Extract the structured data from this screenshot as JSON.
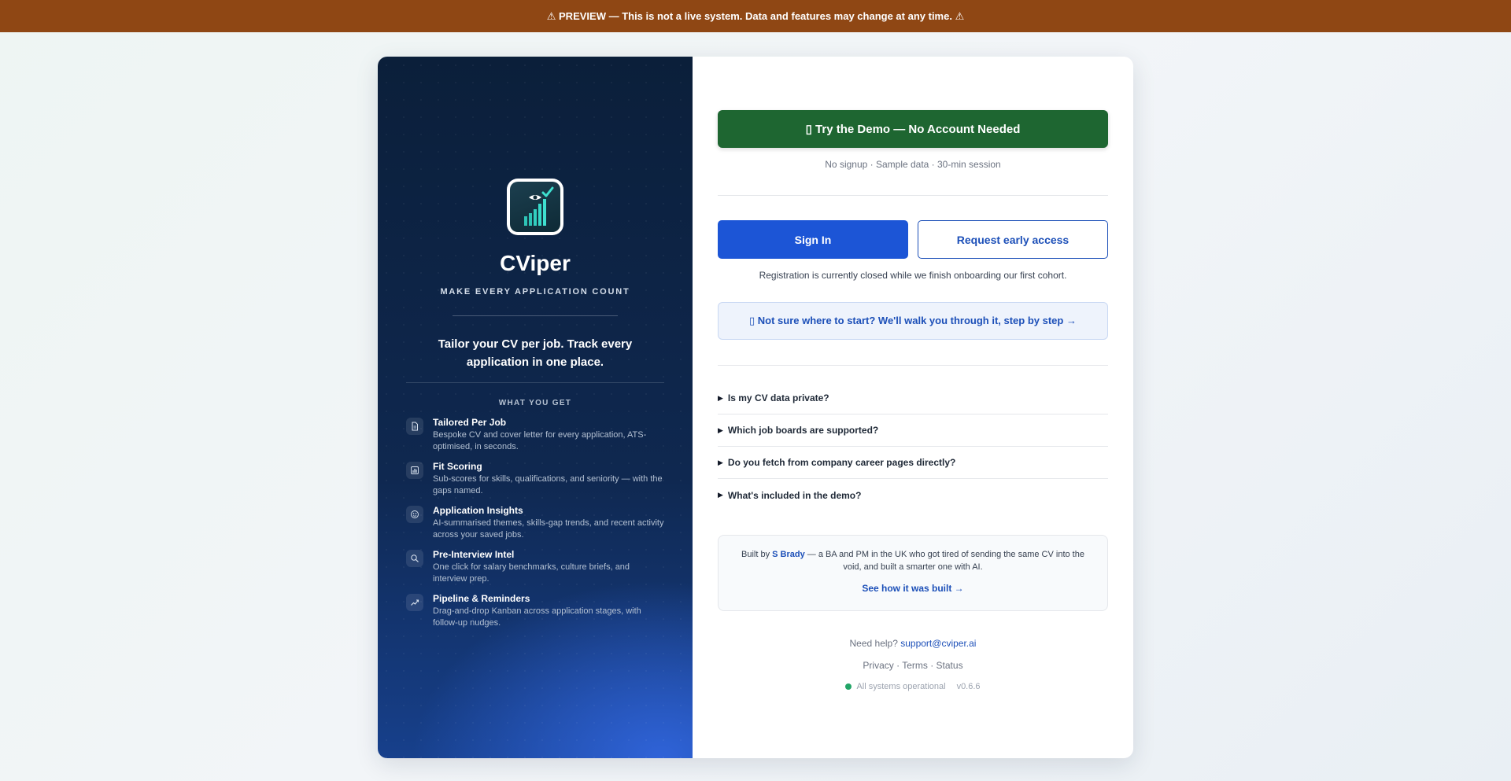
{
  "banner": {
    "text": "⚠ PREVIEW — This is not a live system. Data and features may change at any time. ⚠"
  },
  "brand": {
    "name": "CViper",
    "tagline": "MAKE EVERY APPLICATION COUNT",
    "headline": "Tailor your CV per job. Track every application in one place.",
    "logo_icon": "rising-bar-chart-with-check-icon"
  },
  "features_section": {
    "heading": "WHAT YOU GET",
    "items": [
      {
        "icon": "document-icon",
        "title": "Tailored Per Job",
        "desc": "Bespoke CV and cover letter for every application, ATS-optimised, in seconds."
      },
      {
        "icon": "bar-chart-icon",
        "title": "Fit Scoring",
        "desc": "Sub-scores for skills, qualifications, and seniority — with the gaps named."
      },
      {
        "icon": "insights-icon",
        "title": "Application Insights",
        "desc": "AI-summarised themes, skills-gap trends, and recent activity across your saved jobs."
      },
      {
        "icon": "magnifier-icon",
        "title": "Pre-Interview Intel",
        "desc": "One click for salary benchmarks, culture briefs, and interview prep."
      },
      {
        "icon": "trend-up-icon",
        "title": "Pipeline & Reminders",
        "desc": "Drag-and-drop Kanban across application stages, with follow-up nudges."
      }
    ]
  },
  "demo": {
    "button_label": "▯ Try the Demo — No Account Needed",
    "subtext": "No signup · Sample data · 30-min session"
  },
  "auth": {
    "sign_in_label": "Sign In",
    "request_access_label": "Request early access",
    "registration_note": "Registration is currently closed while we finish onboarding our first cohort."
  },
  "guide": {
    "label": "▯ Not sure where to start? We'll walk you through it, step by step →"
  },
  "faq": [
    {
      "question": "Is my CV data private?"
    },
    {
      "question": "Which job boards are supported?"
    },
    {
      "question": "Do you fetch from company career pages directly?"
    },
    {
      "question": "What's included in the demo?"
    }
  ],
  "built_by": {
    "prefix": "Built by ",
    "author": "S Brady",
    "suffix": " — a BA and PM in the UK who got tired of sending the same CV into the void, and built a smarter one with AI.",
    "link_label": "See how it was built →"
  },
  "footer": {
    "help_prefix": "Need help? ",
    "support_email": "support@cviper.ai",
    "privacy": "Privacy",
    "terms": "Terms",
    "status": "Status",
    "separator": " · ",
    "system_status": "All systems operational",
    "version": "v0.6.6",
    "status_color": "#22a567"
  },
  "colors": {
    "banner": "#8f4714",
    "demo_button": "#1e6631",
    "sign_in_button": "#1c55d6",
    "link": "#1c4fb8",
    "panel_dark": "#0b1f3a"
  }
}
